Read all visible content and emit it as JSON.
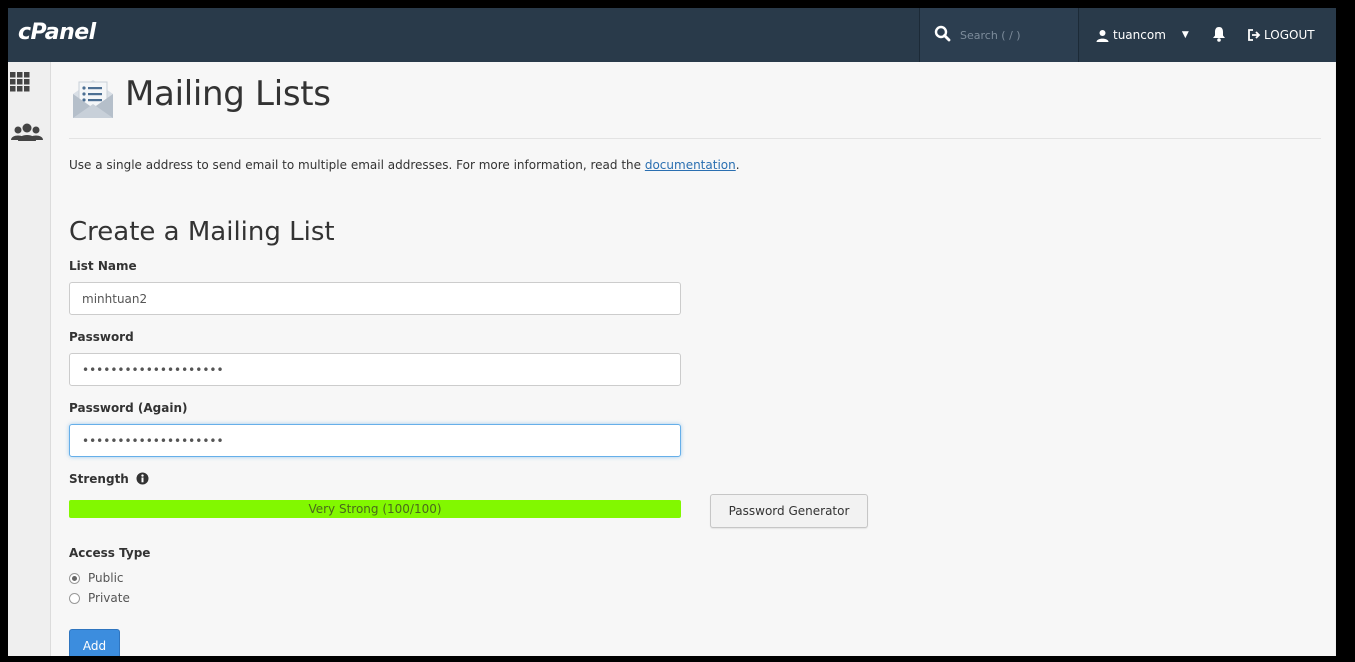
{
  "app": {
    "logo": "cPanel"
  },
  "topbar": {
    "search_placeholder": "Search ( / )",
    "username": "tuancom",
    "logout_label": "LOGOUT"
  },
  "page": {
    "title": "Mailing Lists",
    "description_prefix": "Use a single address to send email to multiple email addresses. For more information, read the ",
    "description_link": "documentation",
    "description_suffix": "."
  },
  "form": {
    "section_title": "Create a Mailing List",
    "list_name_label": "List Name",
    "list_name_value": "minhtuan2",
    "password_label": "Password",
    "password_value": "••••••••••••••••••••",
    "password_again_label": "Password (Again)",
    "password_again_value": "••••••••••••••••••••",
    "strength_label": "Strength",
    "strength_text": "Very Strong (100/100)",
    "strength_percent": 100,
    "password_generator_label": "Password Generator",
    "access_type_label": "Access Type",
    "access_options": [
      {
        "label": "Public",
        "checked": true
      },
      {
        "label": "Private",
        "checked": false
      }
    ],
    "add_label": "Add"
  },
  "colors": {
    "topbar": "#293a4a",
    "strength_fill": "#82f800",
    "primary_button": "#3c8dde",
    "link": "#2a6fb1"
  }
}
